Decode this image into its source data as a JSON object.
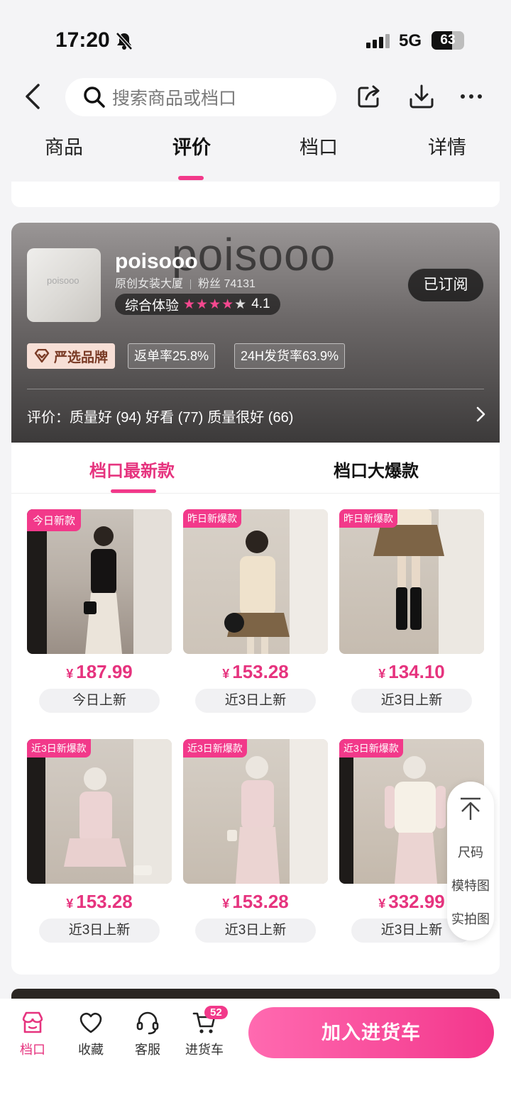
{
  "status": {
    "time": "17:20",
    "network": "5G",
    "battery": "63",
    "battery_level": 0.63
  },
  "search": {
    "placeholder": "搜索商品或档口"
  },
  "tabs": [
    {
      "label": "商品"
    },
    {
      "label": "评价"
    },
    {
      "label": "档口"
    },
    {
      "label": "详情"
    }
  ],
  "shop": {
    "watermark": "poisooo",
    "logo_text": "poisooo",
    "name": "poisooo",
    "building": "原创女装大厦",
    "fans": "粉丝 74131",
    "rating_label": "综合体验",
    "stars": "★★★★",
    "star_grey": "★",
    "score": "4.1",
    "subscribe": "已订阅",
    "brand": "严选品牌",
    "return_rate": "返单率25.8%",
    "ship_rate": "24H发货率63.9%",
    "reviews_label": "评价：",
    "review_tags": [
      "质量好 (94)",
      "好看 (77)",
      "质量很好 (66)"
    ]
  },
  "product_tabs": {
    "newest": "档口最新款",
    "hot": "档口大爆款"
  },
  "products": [
    {
      "badge": "今日新款",
      "price": "187.99",
      "tag": "今日上新"
    },
    {
      "badge": "昨日新爆款",
      "price": "153.28",
      "tag": "近3日上新"
    },
    {
      "badge": "昨日新爆款",
      "price": "134.10",
      "tag": "近3日上新"
    },
    {
      "badge": "近3日新爆款",
      "price": "153.28",
      "tag": "近3日上新"
    },
    {
      "badge": "近3日新爆款",
      "price": "153.28",
      "tag": "近3日上新"
    },
    {
      "badge": "近3日新爆款",
      "price": "332.99",
      "tag": "近3日上新"
    }
  ],
  "currency": "¥",
  "side_menu": [
    "尺码",
    "模特图",
    "实拍图"
  ],
  "bottom": {
    "shop": "档口",
    "favorite": "收藏",
    "service": "客服",
    "cart": "进货车",
    "cart_count": "52",
    "add_to_cart": "加入进货车"
  },
  "colors": {
    "accent": "#f2398a",
    "price": "#e6337e"
  }
}
